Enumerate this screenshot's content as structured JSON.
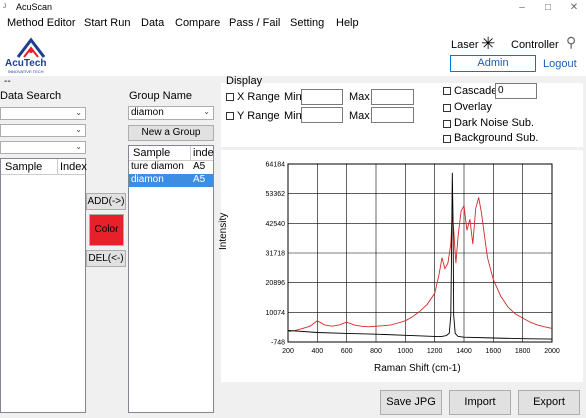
{
  "app": {
    "title": "AcuScan",
    "logo_text": "AcuTech",
    "logo_sub": "INNOVATIVE TECH"
  },
  "window_controls": {
    "minimize": "–",
    "maximize": "□",
    "close": "✕"
  },
  "menu": [
    "Method Editor",
    "Start Run",
    "Data",
    "Compare",
    "Pass / Fail",
    "Setting",
    "Help"
  ],
  "header": {
    "laser_label": "Laser",
    "controller_label": "Controller",
    "user": "Admin",
    "logout": "Logout"
  },
  "left": {
    "dash": "--",
    "data_search_label": "Data Search",
    "columns": [
      "Sample",
      "Index"
    ]
  },
  "middle": {
    "add_button": "ADD(->)",
    "color_button": "Color",
    "del_button": "DEL(<-)",
    "color_swatch": "#e8202a"
  },
  "group": {
    "label": "Group Name",
    "selected": "diamon",
    "new_group_button": "New a Group",
    "columns": [
      "Sample",
      "inde"
    ],
    "rows": [
      {
        "sample": "ture diamon",
        "index": "A5",
        "selected": false
      },
      {
        "sample": "diamon",
        "index": "A5",
        "selected": true
      }
    ]
  },
  "display": {
    "label": "Display",
    "x_range": {
      "label": "X Range",
      "min_label": "Min",
      "max_label": "Max"
    },
    "y_range": {
      "label": "Y Range",
      "min_label": "Min",
      "max_label": "Max"
    },
    "cascade": {
      "label": "Cascade",
      "value": "0"
    },
    "overlay": "Overlay",
    "dark_noise": "Dark Noise Sub.",
    "background": "Background Sub."
  },
  "buttons": {
    "save_jpg": "Save JPG",
    "import": "Import",
    "export": "Export"
  },
  "chart_data": {
    "type": "line",
    "xlabel": "Raman Shift (cm-1)",
    "ylabel": "Intensity",
    "xlim": [
      200,
      2000
    ],
    "ylim": [
      -748,
      64184
    ],
    "x_ticks": [
      200,
      400,
      600,
      800,
      1000,
      1200,
      1400,
      1600,
      1800,
      2000
    ],
    "y_ticks": [
      -748,
      10074,
      20896,
      31718,
      42540,
      53362,
      64184
    ],
    "grid": true,
    "series": [
      {
        "color": "#d62728",
        "x": [
          200,
          250,
          300,
          350,
          400,
          450,
          500,
          550,
          600,
          650,
          700,
          750,
          800,
          850,
          900,
          950,
          1000,
          1050,
          1100,
          1150,
          1200,
          1230,
          1250,
          1270,
          1290,
          1310,
          1320,
          1330,
          1345,
          1360,
          1380,
          1400,
          1420,
          1440,
          1460,
          1480,
          1500,
          1520,
          1540,
          1560,
          1600,
          1650,
          1700,
          1750,
          1800,
          1850,
          1900,
          1950,
          2000
        ],
        "y": [
          3000,
          3500,
          4200,
          5000,
          7000,
          5500,
          5000,
          5500,
          6500,
          5500,
          5000,
          4800,
          5000,
          5200,
          5500,
          6200,
          7000,
          8500,
          10500,
          13000,
          17000,
          24000,
          30000,
          26000,
          28000,
          35000,
          46000,
          40000,
          28000,
          38000,
          47000,
          49000,
          40000,
          44000,
          35000,
          48000,
          52000,
          46000,
          38000,
          30000,
          22000,
          16000,
          12000,
          9500,
          8000,
          6500,
          5500,
          4800,
          4200
        ]
      },
      {
        "color": "#000000",
        "x": [
          200,
          400,
          600,
          800,
          1000,
          1200,
          1250,
          1280,
          1300,
          1310,
          1315,
          1320,
          1325,
          1330,
          1340,
          1360,
          1400,
          1600,
          1800,
          2000
        ],
        "y": [
          3500,
          2700,
          2400,
          2100,
          1700,
          1300,
          1300,
          1600,
          2500,
          9000,
          30000,
          61000,
          45000,
          9000,
          2400,
          1300,
          1000,
          700,
          450,
          300
        ]
      }
    ]
  }
}
